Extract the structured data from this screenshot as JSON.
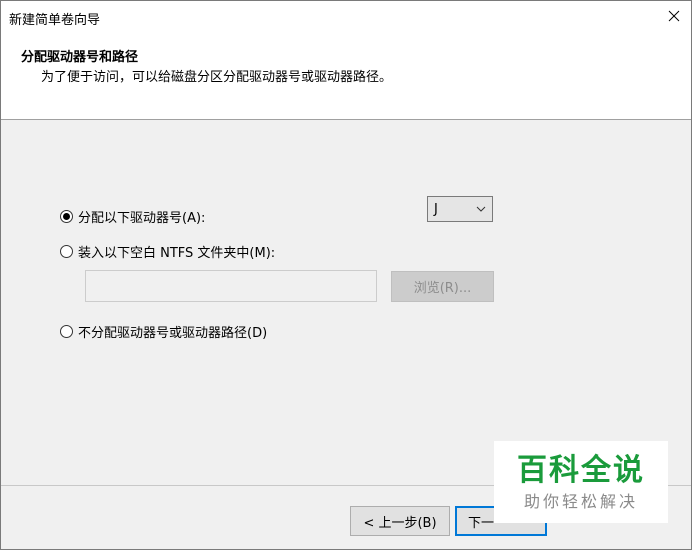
{
  "window": {
    "title": "新建简单卷向导"
  },
  "header": {
    "heading": "分配驱动器号和路径",
    "subheading": "为了便于访问，可以给磁盘分区分配驱动器号或驱动器路径。"
  },
  "options": {
    "assign_letter": {
      "label": "分配以下驱动器号(A):",
      "selected": true
    },
    "mount_folder": {
      "label": "装入以下空白 NTFS 文件夹中(M):",
      "selected": false
    },
    "no_assign": {
      "label": "不分配驱动器号或驱动器路径(D)",
      "selected": false
    }
  },
  "drive_letter": {
    "value": "J"
  },
  "path_input": {
    "value": ""
  },
  "browse_button": {
    "label": "浏览(R)..."
  },
  "footer": {
    "back_label": "< 上一步(B)",
    "next_label": "下一"
  },
  "watermark": {
    "big": "百科全说",
    "small": "助你轻松解决"
  },
  "icons": {
    "close": "close-icon",
    "dropdown": "chevron-down-icon"
  }
}
